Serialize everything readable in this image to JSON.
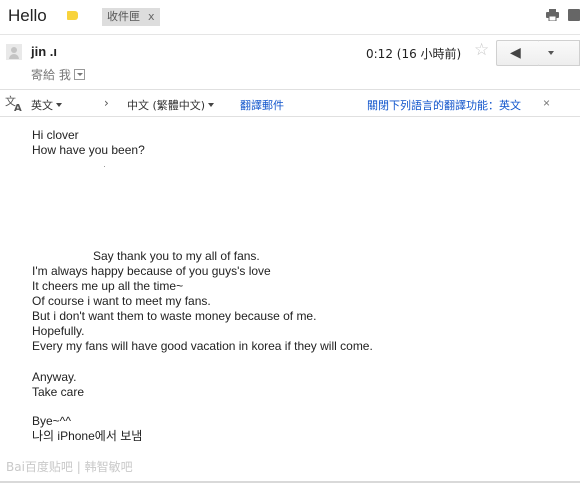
{
  "header": {
    "subject": "Hello",
    "label_color": "#f8d33c",
    "inbox_tag": "收件匣",
    "inbox_tag_close": "x",
    "icons": [
      "print-icon",
      "new-window-icon"
    ]
  },
  "message": {
    "sender": "jin .ı",
    "recipient": "寄給 我",
    "timestamp": "0:12 (16 小時前)",
    "star_glyph": "☆",
    "reply_glyph": "◀"
  },
  "translation_bar": {
    "from_lang": "英文",
    "arrow": "›",
    "to_lang": "中文 (繁體中文)",
    "translate_link": "翻譯郵件",
    "disable_link": "關閉下列語言的翻譯功能：英文",
    "close": "×",
    "link_color": "#1155cc"
  },
  "body": {
    "lines": [
      "Hi clover",
      "How have you been?",
      "Say thank you to my all of fans.",
      "I'm always happy because of you guys's love",
      "It cheers me up all the time~",
      "Of course i want to meet my fans.",
      "But i don't want them to waste money because of me.",
      "Hopefully.",
      "Every my fans will have good vacation in korea if they will come.",
      "Anyway.",
      "Take care",
      "Bye~^^",
      "나의 iPhone에서 보냄"
    ]
  },
  "watermark": "Bai百度贴吧 | 韩智敏吧"
}
